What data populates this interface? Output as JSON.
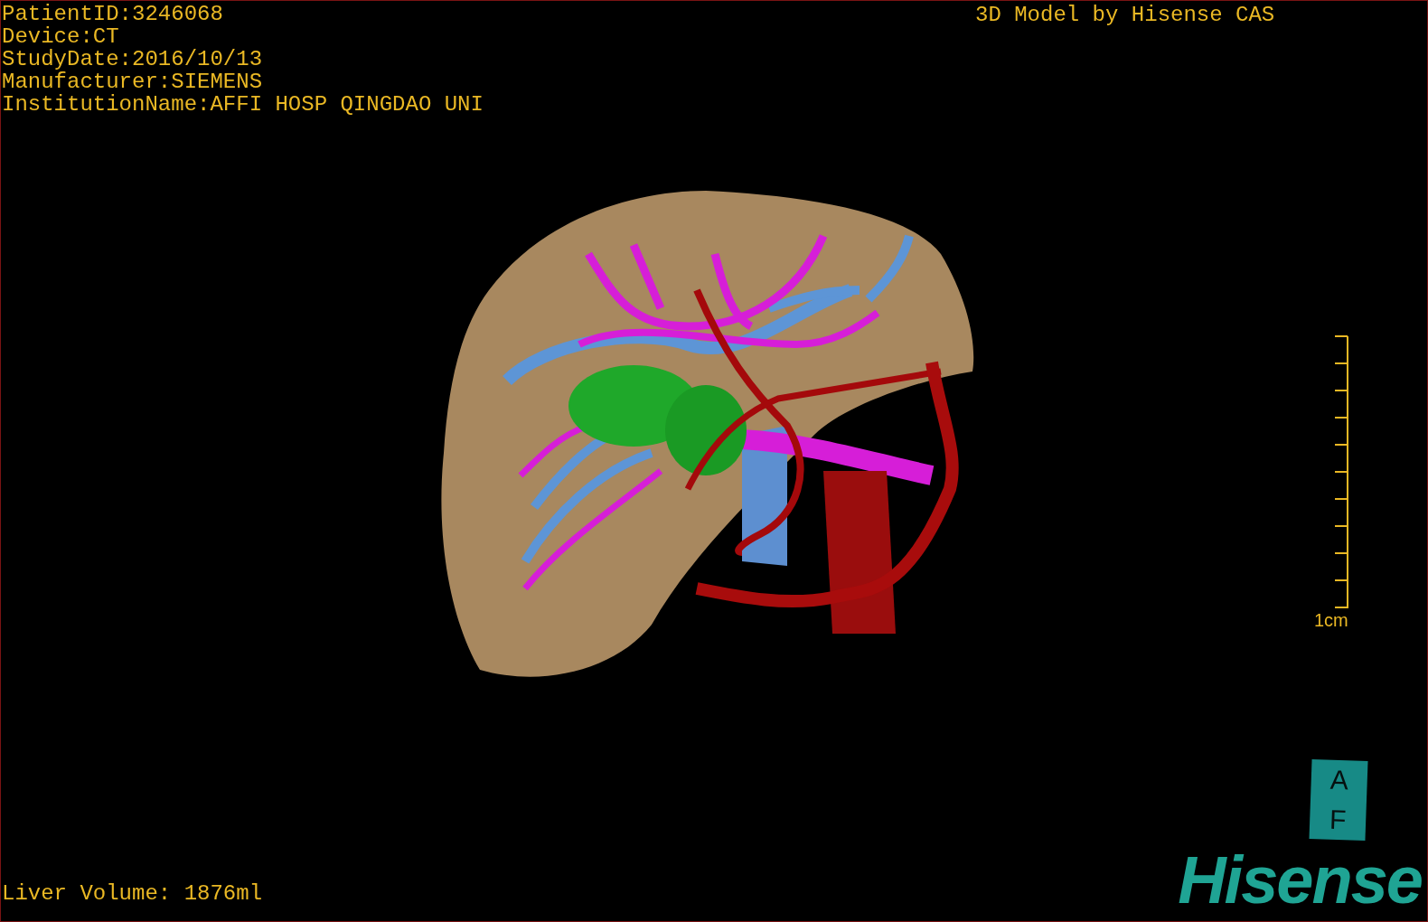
{
  "patient_info": [
    "PatientID:3246068",
    "Device:CT",
    "StudyDate:2016/10/13",
    "Manufacturer:SIEMENS",
    "InstitutionName:AFFI HOSP QINGDAO UNI"
  ],
  "title": "3D Model by Hisense CAS",
  "scale_label": "1cm",
  "orientation_cube": {
    "top": "A",
    "bottom": "F"
  },
  "logo": "Hisense",
  "measurement": "Liver Volume: 1876ml"
}
